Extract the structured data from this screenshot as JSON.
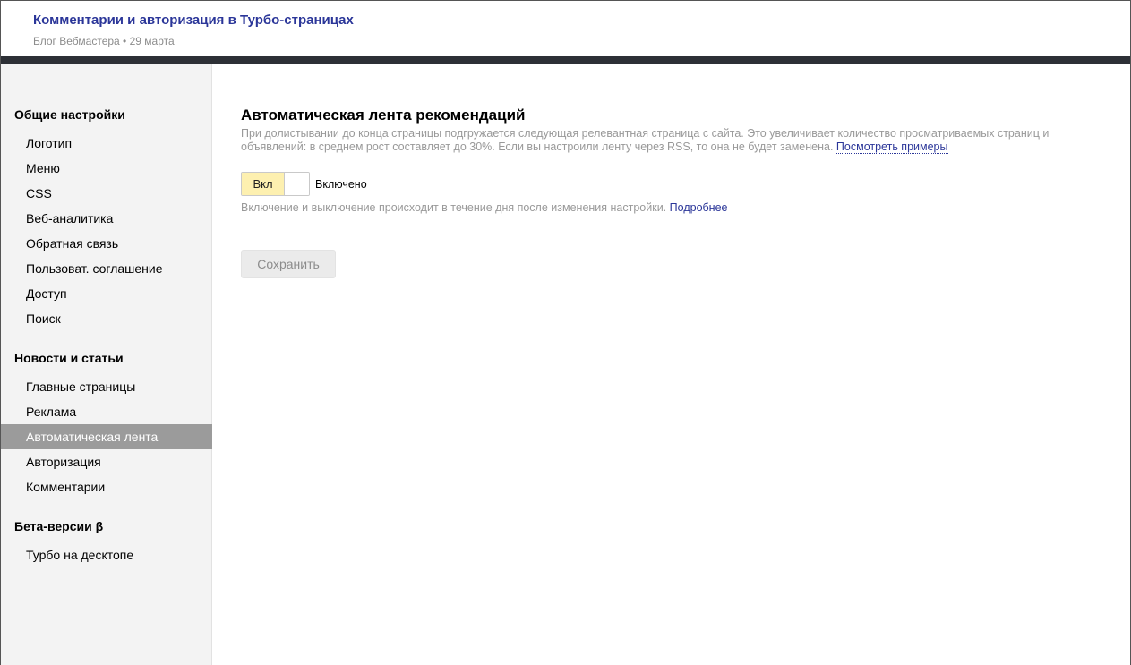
{
  "post": {
    "title": "Комментарии и авторизация в Турбо-страницах",
    "meta": "Блог Вебмастера • 29 марта"
  },
  "sidebar": {
    "sections": [
      {
        "heading": "Общие настройки",
        "items": [
          "Логотип",
          "Меню",
          "CSS",
          "Веб-аналитика",
          "Обратная связь",
          "Пользоват. соглашение",
          "Доступ",
          "Поиск"
        ]
      },
      {
        "heading": "Новости и статьи",
        "items": [
          "Главные страницы",
          "Реклама",
          "Автоматическая лента",
          "Авторизация",
          "Комментарии"
        ]
      },
      {
        "heading": "Бета-версии β",
        "items": [
          "Турбо на десктопе"
        ]
      }
    ],
    "active_item": "Автоматическая лента"
  },
  "main": {
    "title": "Автоматическая лента рекомендаций",
    "description": "При долистывании до конца страницы подгружается следующая релевантная страница с сайта. Это увеличивает количество просматриваемых страниц и объявлений: в среднем рост составляет до 30%. Если вы настроили ленту через RSS, то она не будет заменена.",
    "examples_link": "Посмотреть примеры",
    "toggle_label": "Вкл",
    "toggle_state": "Включено",
    "hint": "Включение и выключение происходит в течение дня после изменения настройки.",
    "more_link": "Подробнее",
    "save_label": "Сохранить"
  },
  "colors": {
    "link": "#2b3699",
    "toggle_on": "#fdf0b0",
    "active_item_bg": "#9b9b9b",
    "dark_bar": "#2d3036"
  }
}
